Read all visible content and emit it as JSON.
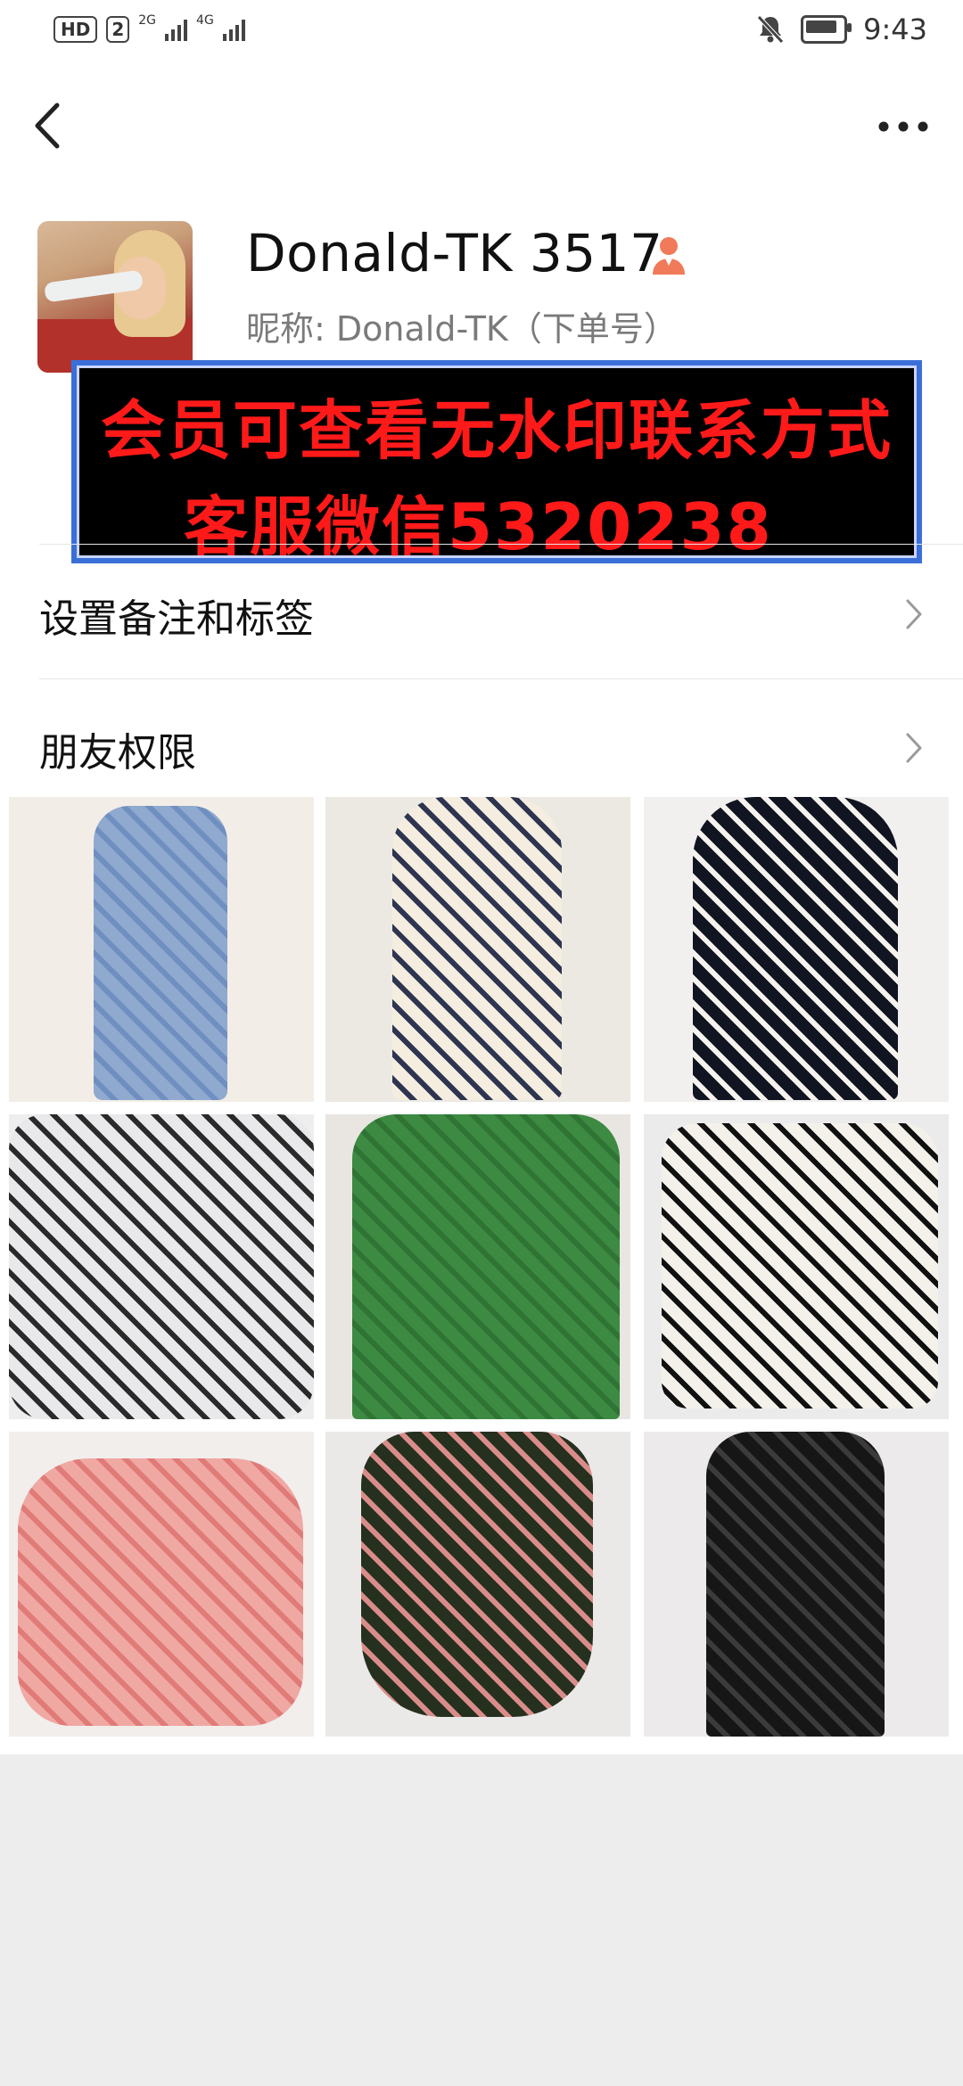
{
  "status_bar": {
    "hd": "HD",
    "sim": "2",
    "net1": "2G",
    "net2": "4G",
    "time": "9:43"
  },
  "profile": {
    "name": "Donald-TK 3517",
    "nickname_label": "昵称:",
    "nickname_value": "Donald-TK（下单号）",
    "badge_icon": "person-icon",
    "badge_color": "#f07a5a"
  },
  "banner": {
    "line1": "会员可查看无水印联系方式",
    "line2": "客服微信5320238",
    "text_color": "#ff1a1a",
    "border_color": "#3b6fd8"
  },
  "menu": {
    "remark": "设置备注和标签",
    "permissions": "朋友权限"
  },
  "icons": {
    "back": "back-arrow-icon",
    "more": "more-icon",
    "chevron": "chevron-right-icon",
    "mute": "bell-mute-icon",
    "battery": "battery-icon"
  },
  "photos": [
    {
      "name": "blue-floral-dress",
      "colors": [
        "#f2ede6",
        "#8fa9cf",
        "#6f8fc0"
      ]
    },
    {
      "name": "cream-floral-dress",
      "colors": [
        "#ece9e3",
        "#f4ede0",
        "#2e3550"
      ]
    },
    {
      "name": "black-collar-dress",
      "colors": [
        "#f1f0ee",
        "#111522",
        "#f6f3ee"
      ]
    },
    {
      "name": "plaid-shirt-dress",
      "colors": [
        "#eeeeee",
        "#e9e9ec",
        "#2a2a2a"
      ]
    },
    {
      "name": "green-polo-shirt",
      "colors": [
        "#e9e6e2",
        "#3d8a43",
        "#2f7434"
      ]
    },
    {
      "name": "white-knit-cardigan",
      "colors": [
        "#ecebeb",
        "#f3f1ea",
        "#111111"
      ]
    },
    {
      "name": "pink-floral-blouse",
      "colors": [
        "#f1eeec",
        "#f0a8a3",
        "#e07b78"
      ]
    },
    {
      "name": "dark-floral-skirt",
      "colors": [
        "#ebe9e8",
        "#26301f",
        "#d98c89"
      ]
    },
    {
      "name": "black-sheer-dress",
      "colors": [
        "#eceaea",
        "#161616",
        "#3b3b3b"
      ]
    }
  ]
}
